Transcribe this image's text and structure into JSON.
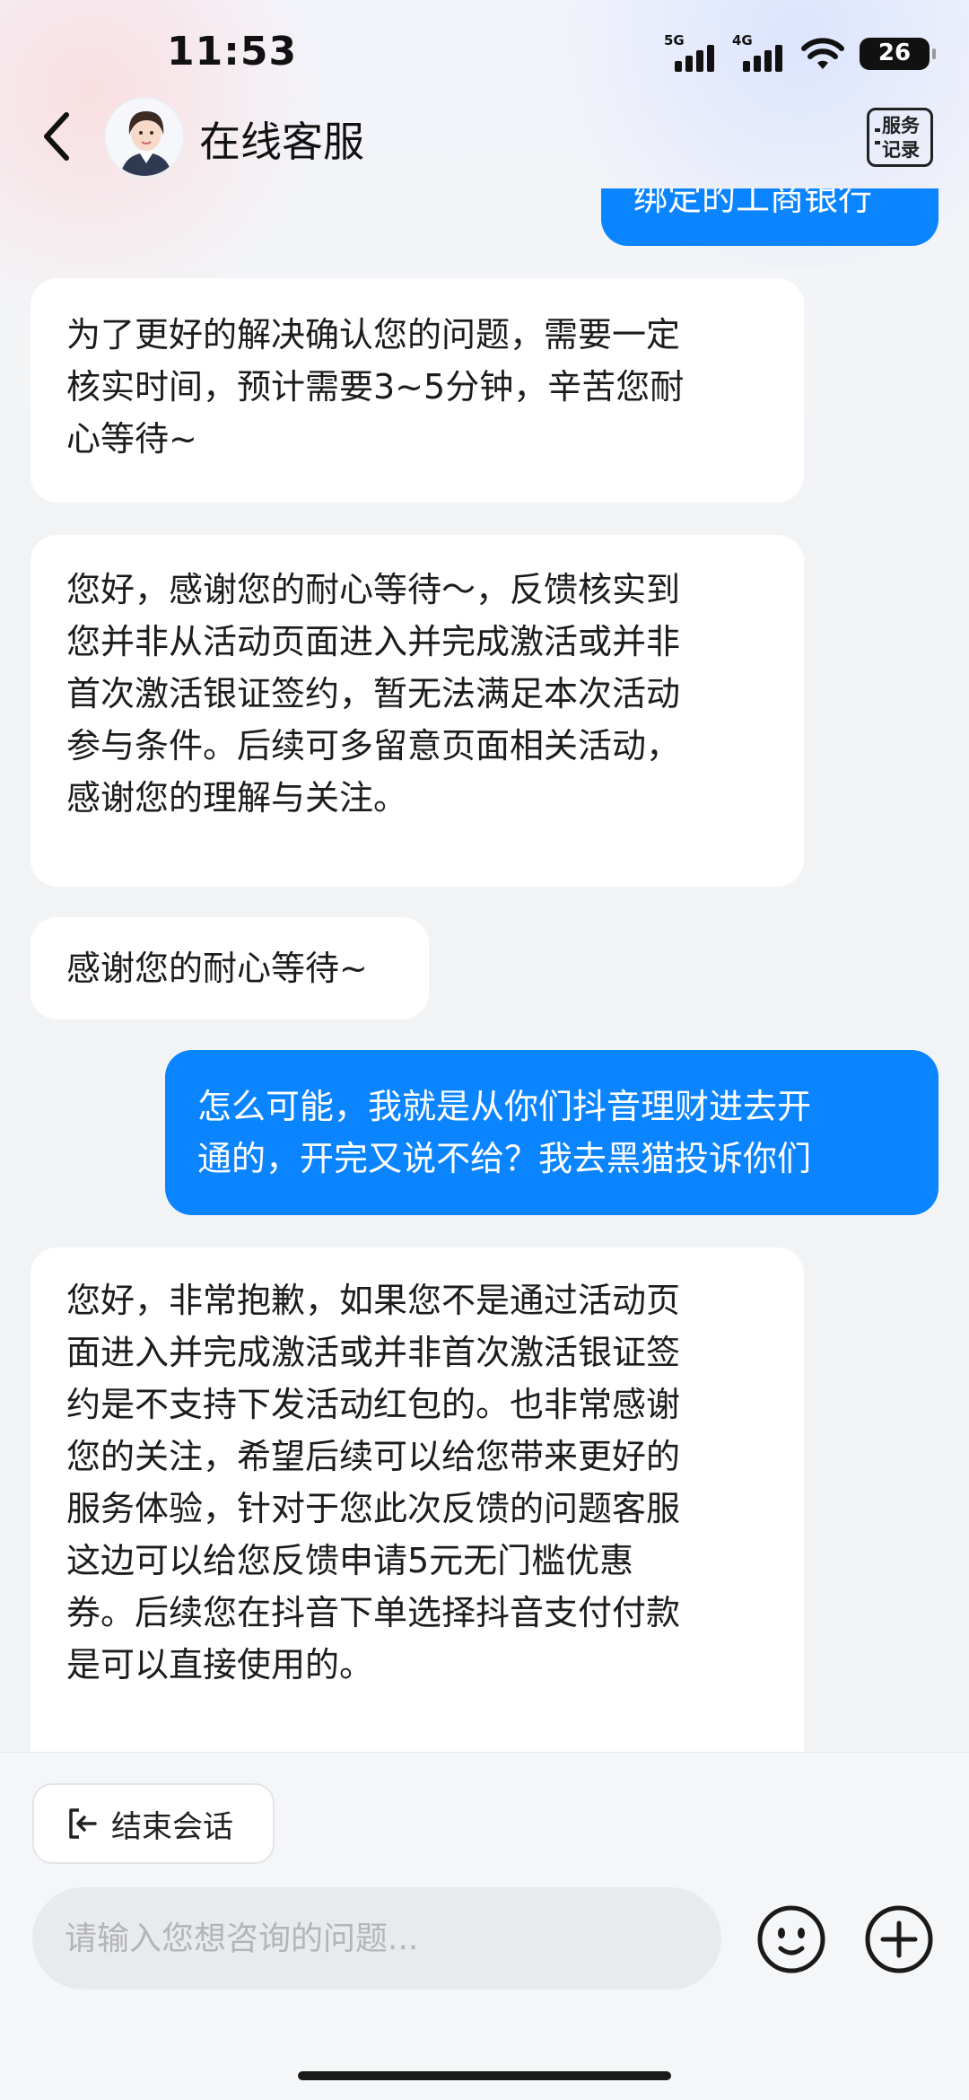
{
  "status_bar": {
    "time": "11:53",
    "signal_1": "5G",
    "signal_2": "4G",
    "battery": "26"
  },
  "header": {
    "title": "在线客服",
    "records_label_line1": "服务",
    "records_label_line2": "记录"
  },
  "messages": [
    {
      "from": "user",
      "lines": [
        "绑定的工商银行"
      ]
    },
    {
      "from": "agent",
      "lines": [
        "为了更好的解决确认您的问题，需要一定",
        "核实时间，预计需要3~5分钟，辛苦您耐",
        "心等待~"
      ]
    },
    {
      "from": "agent",
      "lines": [
        "您好，感谢您的耐心等待～，反馈核实到",
        "您并非从活动页面进入并完成激活或并非",
        "首次激活银证签约，暂无法满足本次活动",
        "参与条件。后续可多留意页面相关活动，",
        "感谢您的理解与关注。"
      ]
    },
    {
      "from": "agent",
      "lines": [
        "感谢您的耐心等待~"
      ]
    },
    {
      "from": "user",
      "lines": [
        "怎么可能，我就是从你们抖音理财进去开",
        "通的，开完又说不给？我去黑猫投诉你们"
      ]
    },
    {
      "from": "agent",
      "lines": [
        "您好，非常抱歉，如果您不是通过活动页",
        "面进入并完成激活或并非首次激活银证签",
        "约是不支持下发活动红包的。也非常感谢",
        "您的关注，希望后续可以给您带来更好的",
        "服务体验，针对于您此次反馈的问题客服",
        "这边可以给您反馈申请5元无门槛优惠",
        "券。后续您在抖音下单选择抖音支付付款",
        "是可以直接使用的。"
      ]
    }
  ],
  "bottom": {
    "end_chat_label": "结束会话",
    "input_placeholder": "请输入您想咨询的问题..."
  },
  "colors": {
    "user_bubble": "#0a84ff",
    "agent_bubble": "#ffffff",
    "background": "#f2f3f5"
  }
}
